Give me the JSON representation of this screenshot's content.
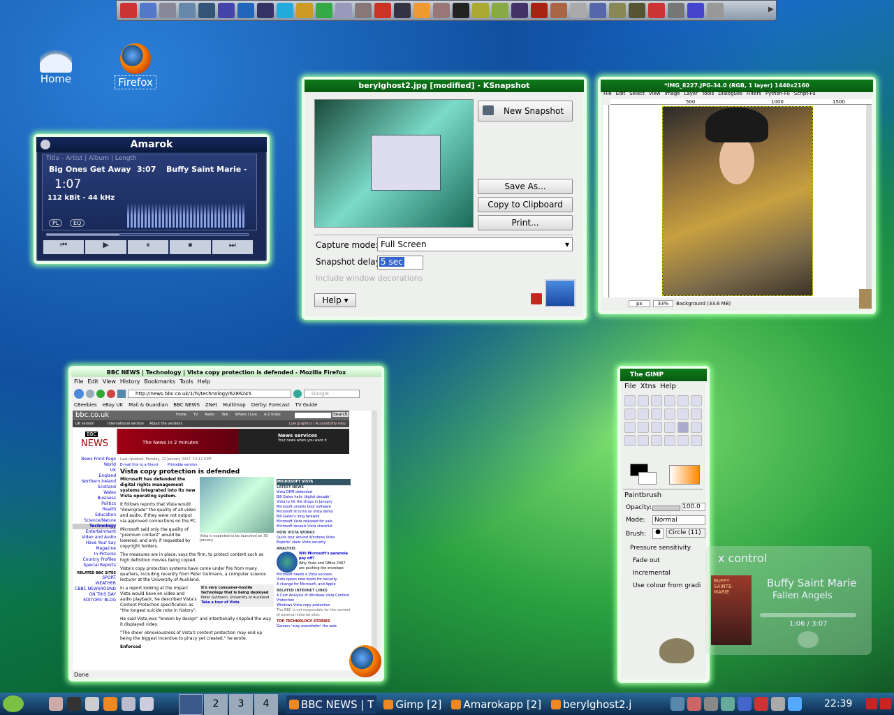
{
  "desktop": {
    "icons": [
      {
        "label": "Home"
      },
      {
        "label": "Firefox"
      }
    ]
  },
  "amarok": {
    "title": "Amarok",
    "columns": "Title - Artist | Album | Length",
    "track": "Big Ones Get Away",
    "length": "3:07",
    "artist": "Buffy Saint Marie - Fa",
    "elapsed": "1:07",
    "bitrate": "112 kBit - 44 kHz",
    "pl": "PL",
    "eq": "EQ",
    "progress": 0.36
  },
  "ksnapshot": {
    "title": "berylghost2.jpg [modified] - KSnapshot",
    "new": "New Snapshot",
    "save": "Save As...",
    "copy": "Copy to Clipboard",
    "print": "Print...",
    "mode_label": "Capture mode:",
    "mode_value": "Full Screen",
    "delay_label": "Snapshot delay:",
    "delay_value": "5 sec",
    "decor": "Include window decorations",
    "help": "Help"
  },
  "gimp_img": {
    "title": "*IMG_8227.JPG-34.0 (RGB, 1 layer) 1440x2160",
    "menu": [
      "File",
      "Edit",
      "Select",
      "View",
      "Image",
      "Layer",
      "Tools",
      "Dialogues",
      "Filters",
      "Python-Fu",
      "Script-Fu"
    ],
    "ruler": [
      "500",
      "1000",
      "1500"
    ],
    "unit": "px",
    "zoom": "33%",
    "status": "Background (33.6 MB)"
  },
  "firefox": {
    "title": "BBC NEWS | Technology | Vista copy protection is defended - Mozilla Firefox",
    "menu": [
      "File",
      "Edit",
      "View",
      "History",
      "Bookmarks",
      "Tools",
      "Help"
    ],
    "url": "http://news.bbc.co.uk/1/hi/technology/6286245",
    "search": "Google",
    "bookmarks": [
      "CBeebies",
      "eBay UK",
      "Mail & Guardian",
      "BBC NEWS",
      "ZNet",
      "Multimap",
      "Derby: Forecast",
      "TV Guide"
    ],
    "site": "bbc.co.uk",
    "nav": [
      "Home",
      "TV",
      "Radio",
      "Talk",
      "Where I Live",
      "A-Z Index"
    ],
    "search_btn": "Search",
    "uk": "UK version",
    "intl": "International version",
    "about": "About the versions",
    "lowgfx": "Low graphics | Accessibility help",
    "logo1": "BBC",
    "logo2": "NEWS",
    "news2": "The News in 2 minutes",
    "services": "News services",
    "services2": "Your news when you want it",
    "sidebar": [
      "News Front Page",
      "World",
      "UK",
      "England",
      "Northern Ireland",
      "Scotland",
      "Wales",
      "Business",
      "Politics",
      "Health",
      "Education",
      "Science/Nature",
      "Technology",
      "Entertainment",
      "Video and Audio",
      "Have Your Say",
      "Magazine",
      "In Pictures",
      "Country Profiles",
      "Special Reports"
    ],
    "related_h": "RELATED BBC SITES",
    "related": [
      "SPORT",
      "WEATHER",
      "CBBC NEWSROUND",
      "ON THIS DAY",
      "EDITORS' BLOG"
    ],
    "updated": "Last Updated: Monday, 22 January 2007, 12:12 GMT",
    "email": "E-mail this to a friend",
    "printable": "Printable version",
    "headline": "Vista copy protection is defended",
    "lead": "Microsoft has defended the digital rights management systems integrated into its new Vista operating system.",
    "p1": "It follows reports that Vista would \"downgrade\" the quality of all video and audio, if they were not output via approved connections on the PC.",
    "p2": "Microsoft said only the quality of \"premium content\" would be lowered, and only if requested by copyright holders.",
    "p3": "The measures are in place, says the firm, to protect content such as high definition movies being copied.",
    "p4": "Vista's copy protection systems have come under fire from many quarters, including recently from Peter Gutmann, a computer science lecturer at the University of Auckland.",
    "p5": "In a report looking at the impact Vista would have on video and audio playback, he described Vista's Content Protection specification as \"the longest suicide note in history\".",
    "p6": "He said Vista was \"broken by design\" and intentionally crippled the way it displayed video.",
    "p7": "\"The sheer obnoxiousness of Vista's content protection may end up being the biggest incentive to piracy yet created,\" he wrote.",
    "p8": "Enforced",
    "caption": "Vista is expected to be launched on 30 January",
    "quote": "It's very consumer-hostile technology that is being deployed",
    "quote_by": "Peter Gutmann, University of Auckland",
    "tour": "Take a tour of Vista",
    "box_h": "MICROSOFT VISTA",
    "latest": "LATEST NEWS",
    "latest_items": [
      "Vista DRM defended",
      "Bill Gates hails 'digital decade'",
      "Vista to hit the shops in January",
      "Microsoft unveils boot software",
      "Microsoft III turns on Vista demo",
      "Bill Gates's long farewell",
      "Microsoft Vista released for sale",
      "Microsoft reveals Vista checklist"
    ],
    "how": "HOW VISTA WORKS",
    "how_items": [
      "Quick tour around Windows Vista",
      "Experts' view: Vista security"
    ],
    "analysis": "ANALYSIS",
    "analysis_title": "Will Microsoft's paranoia pay off?",
    "analysis_sub": "Why Vista and Office 2007 are pushing the envelope",
    "more_items": [
      "Microsoft needs a Vista success",
      "Vista opens new doors for security",
      "A change for Microsoft, and Apple"
    ],
    "internet_h": "RELATED INTERNET LINKS",
    "internet_items": [
      "A Cost Analysis of Windows Vista Content Protection",
      "Windows Vista copy protection"
    ],
    "bbc_note": "The BBC is not responsible for the content of external internet sites",
    "top_h": "TOP TECHNOLOGY STORIES",
    "top_items": [
      "Gamers 'may overwhelm' the web"
    ],
    "status": "Done"
  },
  "gimp_tb": {
    "title": "The GIMP",
    "menu": [
      "File",
      "Xtns",
      "Help"
    ],
    "tool": "Paintbrush",
    "opacity_label": "Opacity:",
    "opacity": "100.0",
    "mode_label": "Mode:",
    "mode": "Normal",
    "brush_label": "Brush:",
    "brush": "Circle (11)",
    "pressure": "Pressure sensitivity",
    "fade": "Fade out",
    "incremental": "Incremental",
    "colour": "Use colour from gradi"
  },
  "amarok_osd": {
    "title": "x control",
    "artist": "Buffy Saint Marie",
    "album": "Fallen Angels",
    "time": "1:06 / 3:07",
    "cover": "BUFFY SAINTE-MARIE"
  },
  "taskbar": {
    "desktops": [
      "2",
      "3",
      "4"
    ],
    "tasks": [
      "BBC NEWS | T",
      "Gimp [2]",
      "Amarokapp [2]",
      "berylghost2.j"
    ],
    "clock": "22:39"
  },
  "colors": {
    "win_glow": "#aaffaa",
    "bbc_red": "#9a0010",
    "title_blue": "#0c3060"
  }
}
